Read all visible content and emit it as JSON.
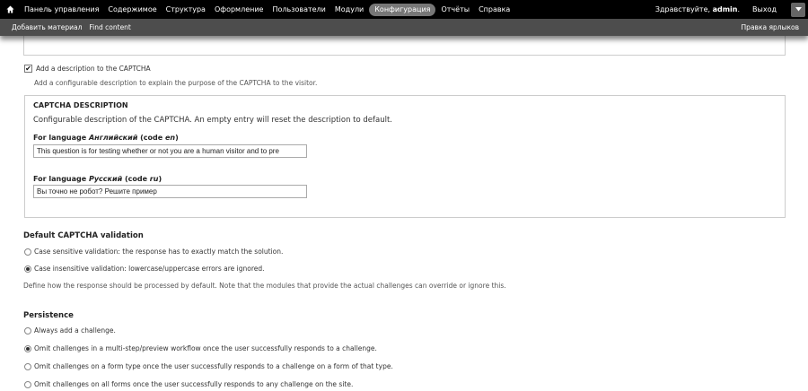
{
  "toolbar": {
    "home_icon": "home-icon",
    "menu": [
      {
        "label": "Панель управления",
        "active": false
      },
      {
        "label": "Содержимое",
        "active": false
      },
      {
        "label": "Структура",
        "active": false
      },
      {
        "label": "Оформление",
        "active": false
      },
      {
        "label": "Пользователи",
        "active": false
      },
      {
        "label": "Модули",
        "active": false
      },
      {
        "label": "Конфигурация",
        "active": true
      },
      {
        "label": "Отчёты",
        "active": false
      },
      {
        "label": "Справка",
        "active": false
      }
    ],
    "hello_prefix": "Здравствуйте, ",
    "username": "admin",
    "hello_suffix": ".",
    "logout": "Выход"
  },
  "shortcuts": {
    "items": [
      "Добавить материал",
      "Find content"
    ],
    "edit": "Правка ярлыков"
  },
  "form": {
    "add_description": {
      "label": "Add a description to the CAPTCHA",
      "checked": true,
      "help": "Add a configurable description to explain the purpose of the CAPTCHA to the visitor."
    },
    "captcha_description": {
      "legend": "CAPTCHA DESCRIPTION",
      "help": "Configurable description of the CAPTCHA. An empty entry will reset the description to default.",
      "languages": [
        {
          "prefix": "For language ",
          "name": "Английский",
          "code_prefix": " (code ",
          "code": "en",
          "code_suffix": ")",
          "value": "This question is for testing whether or not you are a human visitor and to pre"
        },
        {
          "prefix": "For language ",
          "name": "Русский",
          "code_prefix": " (code ",
          "code": "ru",
          "code_suffix": ")",
          "value": "Вы точно не робот? Решите пример"
        }
      ]
    },
    "validation": {
      "title": "Default CAPTCHA validation",
      "options": [
        {
          "label": "Case sensitive validation: the response has to exactly match the solution.",
          "selected": false
        },
        {
          "label": "Case insensitive validation: lowercase/uppercase errors are ignored.",
          "selected": true
        }
      ],
      "help": "Define how the response should be processed by default. Note that the modules that provide the actual challenges can override or ignore this."
    },
    "persistence": {
      "title": "Persistence",
      "options": [
        {
          "label": "Always add a challenge.",
          "selected": false
        },
        {
          "label": "Omit challenges in a multi-step/preview workflow once the user successfully responds to a challenge.",
          "selected": true
        },
        {
          "label": "Omit challenges on a form type once the user successfully responds to a challenge on a form of that type.",
          "selected": false
        },
        {
          "label": "Omit challenges on all forms once the user successfully responds to any challenge on the site.",
          "selected": false
        }
      ]
    }
  }
}
